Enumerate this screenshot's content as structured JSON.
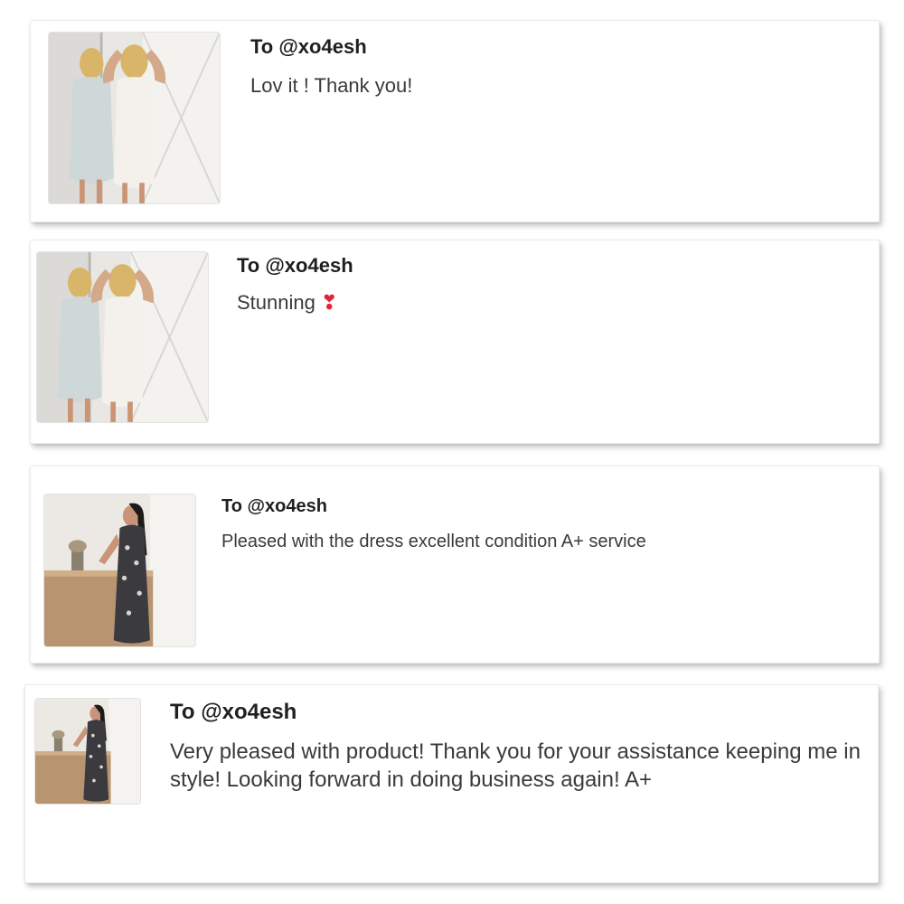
{
  "reviews": [
    {
      "to": "To @xo4esh",
      "message": "Lov it ! Thank you!",
      "photo": "white-lace-dress-photo"
    },
    {
      "to": "To @xo4esh",
      "message": "Stunning ",
      "emoji": "❣",
      "photo": "white-lace-dress-photo"
    },
    {
      "to": "To @xo4esh",
      "message": "Pleased with the dress excellent condition A+ service",
      "photo": "black-lace-dress-photo"
    },
    {
      "to": "To @xo4esh",
      "message": "Very pleased with product! Thank you for your assistance keeping me in style! Looking forward in doing business again! A+",
      "photo": "black-lace-dress-photo"
    }
  ],
  "colors": {
    "heart": "#e0243a",
    "card_bg": "#ffffff",
    "text": "#2b2b2b"
  }
}
